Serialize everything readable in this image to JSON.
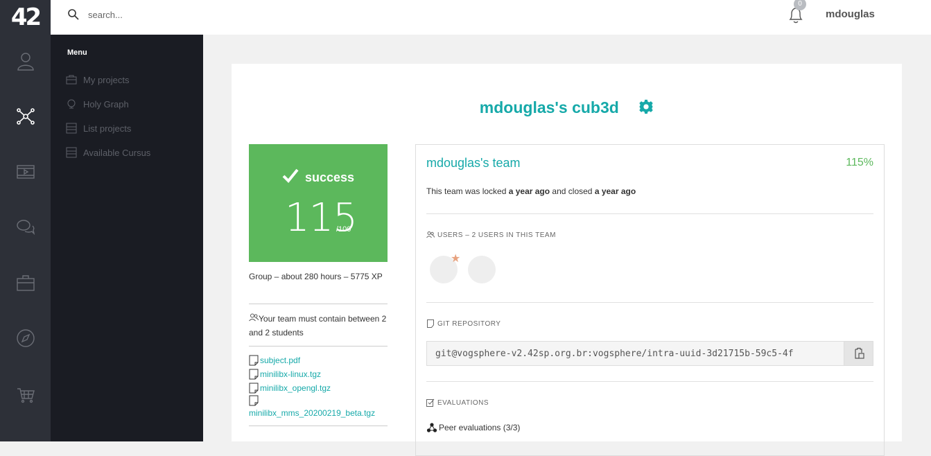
{
  "app": {
    "logo": "42"
  },
  "rail": {
    "items": [
      "profile-icon",
      "holy-graph-icon",
      "video-icon",
      "forum-icon",
      "projects-icon",
      "compass-icon",
      "shop-icon"
    ],
    "active_index": 1
  },
  "search": {
    "placeholder": "search..."
  },
  "header": {
    "notification_count": "0",
    "username": "mdouglas"
  },
  "menu": {
    "title": "Menu",
    "items": [
      {
        "label": "My projects",
        "icon": "briefcase-icon"
      },
      {
        "label": "Holy Graph",
        "icon": "graph-icon"
      },
      {
        "label": "List projects",
        "icon": "list-icon"
      },
      {
        "label": "Available Cursus",
        "icon": "list-icon"
      }
    ]
  },
  "project": {
    "title": "mdouglas's cub3d",
    "status": "success",
    "score": "115",
    "score_max": "/100",
    "details": "Group – about 280 hours – 5775 XP",
    "team_rule": "Your team must contain between 2 and 2 students",
    "files": [
      "subject.pdf",
      "minilibx-linux.tgz",
      "minilibx_opengl.tgz",
      "minilibx_mms_20200219_beta.tgz"
    ]
  },
  "team": {
    "name": "mdouglas's team",
    "grade": "115%",
    "lock_text_1": "This team was locked ",
    "lock_time_1": "a year ago",
    "lock_text_2": " and closed ",
    "lock_time_2": "a year ago",
    "users_label": "USERS – 2 USERS IN THIS TEAM",
    "git_label": "GIT REPOSITORY",
    "git_url": "git@vogsphere-v2.42sp.org.br:vogsphere/intra-uuid-3d21715b-59c5-4f",
    "evaluations_label": "EVALUATIONS",
    "peer_evaluations": "Peer evaluations (3/3)"
  },
  "colors": {
    "accent": "#16a9a9",
    "success": "#5cb85c",
    "rail": "#2d3038",
    "menu": "#1a1c23"
  }
}
